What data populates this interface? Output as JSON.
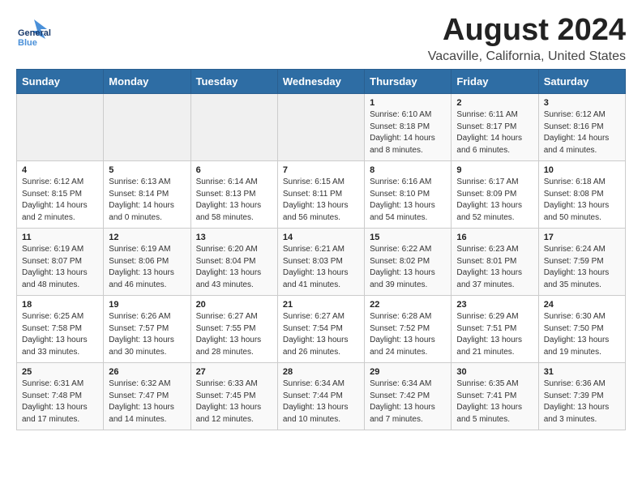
{
  "header": {
    "logo_general": "General",
    "logo_blue": "Blue",
    "main_title": "August 2024",
    "subtitle": "Vacaville, California, United States"
  },
  "calendar": {
    "headers": [
      "Sunday",
      "Monday",
      "Tuesday",
      "Wednesday",
      "Thursday",
      "Friday",
      "Saturday"
    ],
    "weeks": [
      [
        {
          "day": "",
          "info": ""
        },
        {
          "day": "",
          "info": ""
        },
        {
          "day": "",
          "info": ""
        },
        {
          "day": "",
          "info": ""
        },
        {
          "day": "1",
          "info": "Sunrise: 6:10 AM\nSunset: 8:18 PM\nDaylight: 14 hours\nand 8 minutes."
        },
        {
          "day": "2",
          "info": "Sunrise: 6:11 AM\nSunset: 8:17 PM\nDaylight: 14 hours\nand 6 minutes."
        },
        {
          "day": "3",
          "info": "Sunrise: 6:12 AM\nSunset: 8:16 PM\nDaylight: 14 hours\nand 4 minutes."
        }
      ],
      [
        {
          "day": "4",
          "info": "Sunrise: 6:12 AM\nSunset: 8:15 PM\nDaylight: 14 hours\nand 2 minutes."
        },
        {
          "day": "5",
          "info": "Sunrise: 6:13 AM\nSunset: 8:14 PM\nDaylight: 14 hours\nand 0 minutes."
        },
        {
          "day": "6",
          "info": "Sunrise: 6:14 AM\nSunset: 8:13 PM\nDaylight: 13 hours\nand 58 minutes."
        },
        {
          "day": "7",
          "info": "Sunrise: 6:15 AM\nSunset: 8:11 PM\nDaylight: 13 hours\nand 56 minutes."
        },
        {
          "day": "8",
          "info": "Sunrise: 6:16 AM\nSunset: 8:10 PM\nDaylight: 13 hours\nand 54 minutes."
        },
        {
          "day": "9",
          "info": "Sunrise: 6:17 AM\nSunset: 8:09 PM\nDaylight: 13 hours\nand 52 minutes."
        },
        {
          "day": "10",
          "info": "Sunrise: 6:18 AM\nSunset: 8:08 PM\nDaylight: 13 hours\nand 50 minutes."
        }
      ],
      [
        {
          "day": "11",
          "info": "Sunrise: 6:19 AM\nSunset: 8:07 PM\nDaylight: 13 hours\nand 48 minutes."
        },
        {
          "day": "12",
          "info": "Sunrise: 6:19 AM\nSunset: 8:06 PM\nDaylight: 13 hours\nand 46 minutes."
        },
        {
          "day": "13",
          "info": "Sunrise: 6:20 AM\nSunset: 8:04 PM\nDaylight: 13 hours\nand 43 minutes."
        },
        {
          "day": "14",
          "info": "Sunrise: 6:21 AM\nSunset: 8:03 PM\nDaylight: 13 hours\nand 41 minutes."
        },
        {
          "day": "15",
          "info": "Sunrise: 6:22 AM\nSunset: 8:02 PM\nDaylight: 13 hours\nand 39 minutes."
        },
        {
          "day": "16",
          "info": "Sunrise: 6:23 AM\nSunset: 8:01 PM\nDaylight: 13 hours\nand 37 minutes."
        },
        {
          "day": "17",
          "info": "Sunrise: 6:24 AM\nSunset: 7:59 PM\nDaylight: 13 hours\nand 35 minutes."
        }
      ],
      [
        {
          "day": "18",
          "info": "Sunrise: 6:25 AM\nSunset: 7:58 PM\nDaylight: 13 hours\nand 33 minutes."
        },
        {
          "day": "19",
          "info": "Sunrise: 6:26 AM\nSunset: 7:57 PM\nDaylight: 13 hours\nand 30 minutes."
        },
        {
          "day": "20",
          "info": "Sunrise: 6:27 AM\nSunset: 7:55 PM\nDaylight: 13 hours\nand 28 minutes."
        },
        {
          "day": "21",
          "info": "Sunrise: 6:27 AM\nSunset: 7:54 PM\nDaylight: 13 hours\nand 26 minutes."
        },
        {
          "day": "22",
          "info": "Sunrise: 6:28 AM\nSunset: 7:52 PM\nDaylight: 13 hours\nand 24 minutes."
        },
        {
          "day": "23",
          "info": "Sunrise: 6:29 AM\nSunset: 7:51 PM\nDaylight: 13 hours\nand 21 minutes."
        },
        {
          "day": "24",
          "info": "Sunrise: 6:30 AM\nSunset: 7:50 PM\nDaylight: 13 hours\nand 19 minutes."
        }
      ],
      [
        {
          "day": "25",
          "info": "Sunrise: 6:31 AM\nSunset: 7:48 PM\nDaylight: 13 hours\nand 17 minutes."
        },
        {
          "day": "26",
          "info": "Sunrise: 6:32 AM\nSunset: 7:47 PM\nDaylight: 13 hours\nand 14 minutes."
        },
        {
          "day": "27",
          "info": "Sunrise: 6:33 AM\nSunset: 7:45 PM\nDaylight: 13 hours\nand 12 minutes."
        },
        {
          "day": "28",
          "info": "Sunrise: 6:34 AM\nSunset: 7:44 PM\nDaylight: 13 hours\nand 10 minutes."
        },
        {
          "day": "29",
          "info": "Sunrise: 6:34 AM\nSunset: 7:42 PM\nDaylight: 13 hours\nand 7 minutes."
        },
        {
          "day": "30",
          "info": "Sunrise: 6:35 AM\nSunset: 7:41 PM\nDaylight: 13 hours\nand 5 minutes."
        },
        {
          "day": "31",
          "info": "Sunrise: 6:36 AM\nSunset: 7:39 PM\nDaylight: 13 hours\nand 3 minutes."
        }
      ]
    ]
  }
}
